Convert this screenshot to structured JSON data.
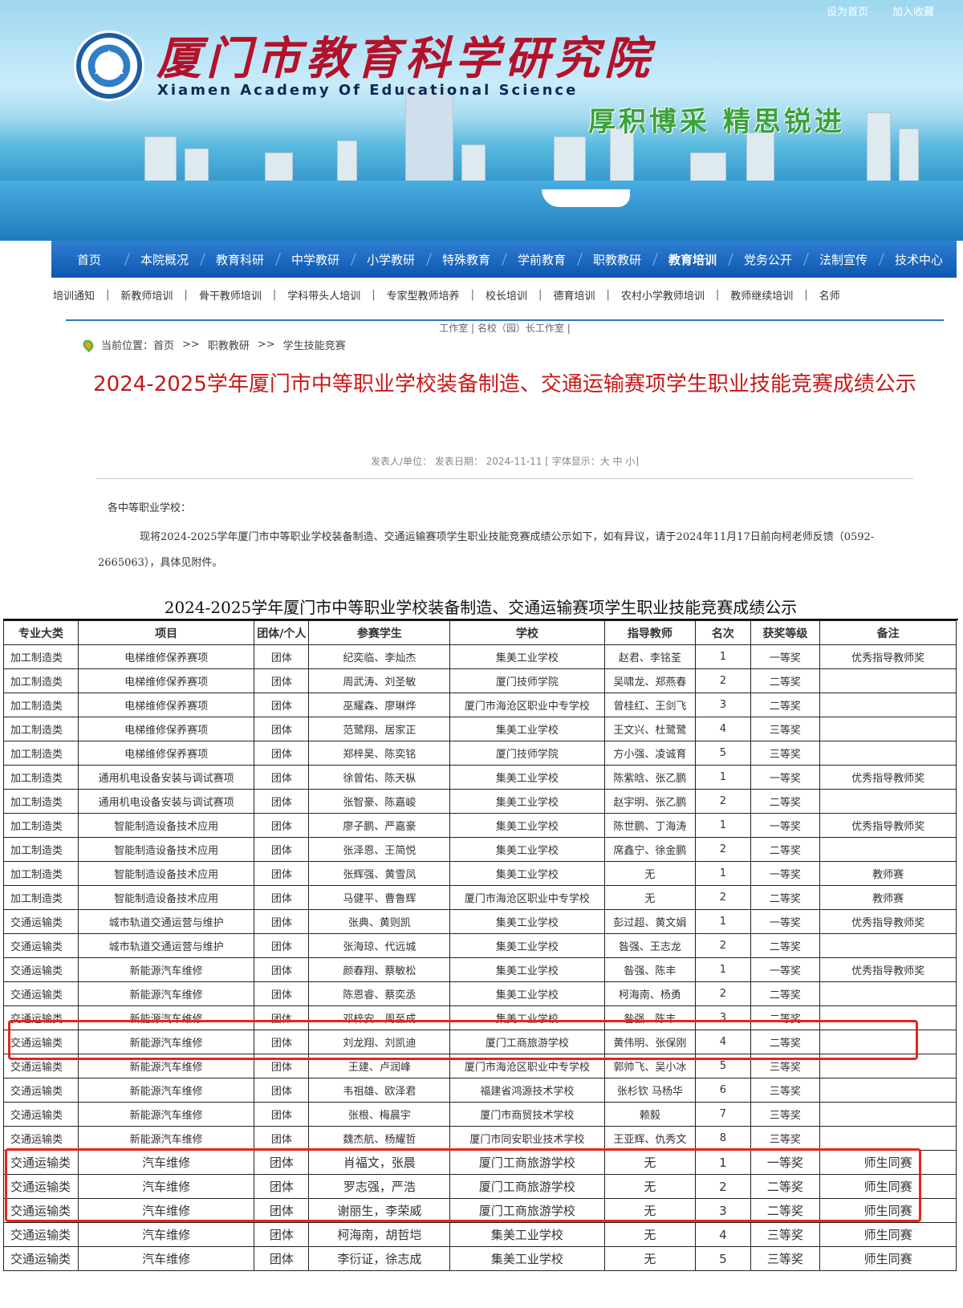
{
  "top_links": [
    "设为首页",
    "加入收藏"
  ],
  "site": {
    "title": "厦门市教育科学研究院",
    "en_name": "Xiamen Academy Of Educational Science",
    "slogan": "厚积博采  精思锐进"
  },
  "nav": [
    "首页",
    "本院概况",
    "教育科研",
    "中学教研",
    "小学教研",
    "特殊教育",
    "学前教育",
    "职教教研",
    "教育培训",
    "党务公开",
    "法制宣传",
    "技术中心"
  ],
  "nav_active": "教育培训",
  "subnav": [
    "培训通知",
    "新教师培训",
    "骨干教师培训",
    "学科带头人培训",
    "专家型教师培养",
    "校长培训",
    "德育培训",
    "农村小学教师培训",
    "教师继续培训",
    "名师"
  ],
  "subnav2": "工作室  |  名校（园）长工作室  |",
  "breadcrumb": {
    "label": "当前位置：首页",
    "sep": ">>",
    "level2": "职教教研",
    "level3": "学生技能竞赛"
  },
  "article": {
    "title": "2024-2025学年厦门市中等职业学校装备制造、交通运输赛项学生职业技能竞赛成绩公示",
    "meta": "发表人/单位：  发表日期：  2024-11-11 [ 字体显示：大 中 小]",
    "greeting": "各中等职业学校：",
    "body": "现将2024-2025学年厦门市中等职业学校装备制造、交通运输赛项学生职业技能竞赛成绩公示如下，如有异议，请于2024年11月17日前向柯老师反馈（0592-2665063），具体见附件。"
  },
  "table": {
    "title": "2024-2025学年厦门市中等职业学校装备制造、交通运输赛项学生职业技能竞赛成绩公示",
    "headers": [
      "专业大类",
      "项目",
      "团体/个人",
      "参赛学生",
      "学校",
      "指导教师",
      "名次",
      "获奖等级",
      "备注"
    ],
    "rows": [
      [
        "加工制造类",
        "电梯维修保养赛项",
        "团体",
        "纪奕临、李灿杰",
        "集美工业学校",
        "赵君、李铭荃",
        "1",
        "一等奖",
        "优秀指导教师奖"
      ],
      [
        "加工制造类",
        "电梯维修保养赛项",
        "团体",
        "周武涛、刘圣敏",
        "厦门技师学院",
        "吴啸龙、郑燕春",
        "2",
        "二等奖",
        ""
      ],
      [
        "加工制造类",
        "电梯维修保养赛项",
        "团体",
        "巫耀森、廖琳烨",
        "厦门市海沧区职业中专学校",
        "曾桂红、王剑飞",
        "3",
        "二等奖",
        ""
      ],
      [
        "加工制造类",
        "电梯维修保养赛项",
        "团体",
        "范鹭翔、居家正",
        "集美工业学校",
        "王文兴、杜鹭鹭",
        "4",
        "三等奖",
        ""
      ],
      [
        "加工制造类",
        "电梯维修保养赛项",
        "团体",
        "郑梓昊、陈奕铭",
        "厦门技师学院",
        "方小强、凌诚育",
        "5",
        "三等奖",
        ""
      ],
      [
        "加工制造类",
        "通用机电设备安装与调试赛项",
        "团体",
        "徐曾佑、陈天枞",
        "集美工业学校",
        "陈紫晗、张乙鹏",
        "1",
        "一等奖",
        "优秀指导教师奖"
      ],
      [
        "加工制造类",
        "通用机电设备安装与调试赛项",
        "团体",
        "张智豪、陈嘉峻",
        "集美工业学校",
        "赵宇明、张乙鹏",
        "2",
        "二等奖",
        ""
      ],
      [
        "加工制造类",
        "智能制造设备技术应用",
        "团体",
        "廖子鹏、严嘉豪",
        "集美工业学校",
        "陈世鹏、丁海涛",
        "1",
        "一等奖",
        "优秀指导教师奖"
      ],
      [
        "加工制造类",
        "智能制造设备技术应用",
        "团体",
        "张泽恩、王简悦",
        "集美工业学校",
        "席鑫宁、徐金鹏",
        "2",
        "二等奖",
        ""
      ],
      [
        "加工制造类",
        "智能制造设备技术应用",
        "团体",
        "张辉强、黄雪凤",
        "集美工业学校",
        "无",
        "1",
        "一等奖",
        "教师赛"
      ],
      [
        "加工制造类",
        "智能制造设备技术应用",
        "团体",
        "马健平、曹鲁辉",
        "厦门市海沧区职业中专学校",
        "无",
        "2",
        "二等奖",
        "教师赛"
      ],
      [
        "交通运输类",
        "城市轨道交通运营与维护",
        "团体",
        "张典、黄则凯",
        "集美工业学校",
        "彭过超、黄文娟",
        "1",
        "一等奖",
        "优秀指导教师奖"
      ],
      [
        "交通运输类",
        "城市轨道交通运营与维护",
        "团体",
        "张海琼、代远城",
        "集美工业学校",
        "昝强、王志龙",
        "2",
        "二等奖",
        ""
      ],
      [
        "交通运输类",
        "新能源汽车维修",
        "团体",
        "颜春翔、蔡敏松",
        "集美工业学校",
        "昝强、陈丰",
        "1",
        "一等奖",
        "优秀指导教师奖"
      ],
      [
        "交通运输类",
        "新能源汽车维修",
        "团体",
        "陈恩睿、蔡奕丞",
        "集美工业学校",
        "柯海南、杨勇",
        "2",
        "二等奖",
        ""
      ],
      [
        "交通运输类",
        "新能源汽车维修",
        "团体",
        "邓梓安、周至成",
        "集美工业学校",
        "昝强、陈丰",
        "3",
        "二等奖",
        ""
      ],
      [
        "交通运输类",
        "新能源汽车维修",
        "团体",
        "刘龙翔、刘凯迪",
        "厦门工商旅游学校",
        "黄伟明、张保刚",
        "4",
        "二等奖",
        ""
      ],
      [
        "交通运输类",
        "新能源汽车维修",
        "团体",
        "王建、卢润峰",
        "厦门市海沧区职业中专学校",
        "郭帅飞、吴小冰",
        "5",
        "三等奖",
        ""
      ],
      [
        "交通运输类",
        "新能源汽车维修",
        "团体",
        "韦祖雄、欧泽君",
        "福建省鸿源技术学校",
        "张杉钦 马杨华",
        "6",
        "三等奖",
        ""
      ],
      [
        "交通运输类",
        "新能源汽车维修",
        "团体",
        "张根、梅晨宇",
        "厦门市商贸技术学校",
        "赖毅",
        "7",
        "三等奖",
        ""
      ],
      [
        "交通运输类",
        "新能源汽车维修",
        "团体",
        "魏杰航、杨耀哲",
        "厦门市同安职业技术学校",
        "王亚辉、仇秀文",
        "8",
        "三等奖",
        ""
      ],
      [
        "交通运输类",
        "汽车维修",
        "团体",
        "肖福文，张晨",
        "厦门工商旅游学校",
        "无",
        "1",
        "一等奖",
        "师生同赛"
      ],
      [
        "交通运输类",
        "汽车维修",
        "团体",
        "罗志强，严浩",
        "厦门工商旅游学校",
        "无",
        "2",
        "二等奖",
        "师生同赛"
      ],
      [
        "交通运输类",
        "汽车维修",
        "团体",
        "谢丽生，李荣威",
        "厦门工商旅游学校",
        "无",
        "3",
        "二等奖",
        "师生同赛"
      ],
      [
        "交通运输类",
        "汽车维修",
        "团体",
        "柯海南，胡哲垲",
        "集美工业学校",
        "无",
        "4",
        "三等奖",
        "师生同赛"
      ],
      [
        "交通运输类",
        "汽车维修",
        "团体",
        "李衍证，徐志成",
        "集美工业学校",
        "无",
        "5",
        "三等奖",
        "师生同赛"
      ]
    ]
  },
  "colors": {
    "title_red": "#c81818",
    "nav_blue": "#0f56b0",
    "highlight": "#e8251b"
  }
}
